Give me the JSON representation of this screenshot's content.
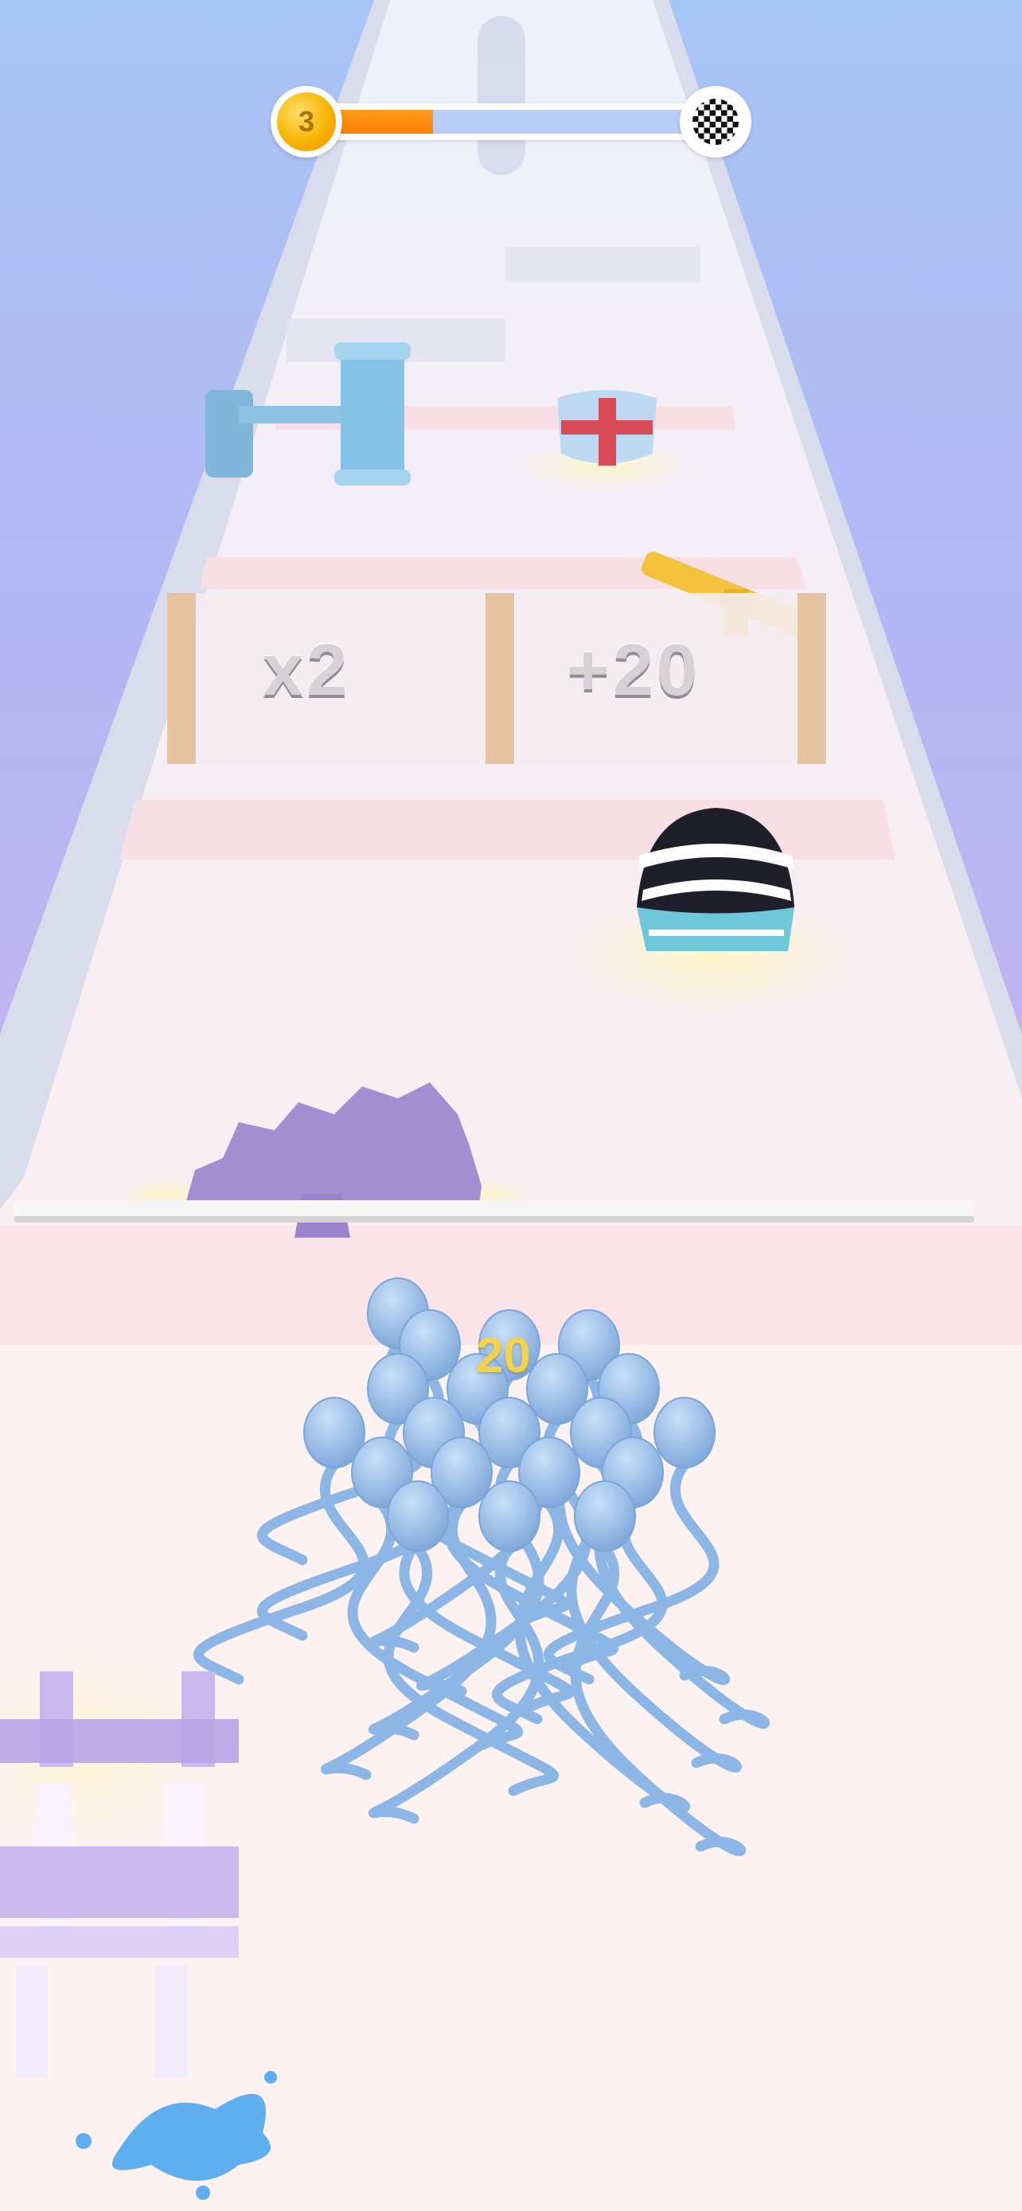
{
  "hud": {
    "level_number": "3",
    "progress_fraction": 0.31,
    "colors": {
      "fill": "#ff8a00",
      "badge": "#f7b400"
    }
  },
  "gates": {
    "left_label": "x2",
    "right_label": "+20"
  },
  "crowd": {
    "count": "20",
    "color": "#8bb6e6"
  },
  "icons": [
    "level-badge-icon",
    "finish-flag-icon",
    "hammer-obstacle-icon",
    "shield-powerup-icon",
    "striped-helmet-powerup-icon",
    "saw-blade-icon",
    "spike-trap-icon"
  ]
}
